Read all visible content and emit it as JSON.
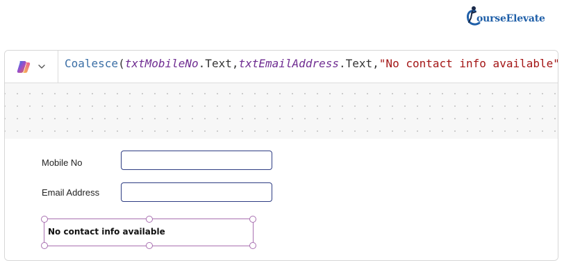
{
  "brand": {
    "logo_text": "ourseElevate",
    "logo_letter": "C",
    "color": "#1f5fa8"
  },
  "formula_bar": {
    "copilot_icon": "copilot-icon",
    "dropdown_icon": "chevron-down-icon",
    "formula": {
      "fn": "Coalesce",
      "open": "(",
      "arg1_control": "txtMobileNo",
      "arg1_prop": ".Text",
      "comma1": ",",
      "arg2_control": "txtEmailAddress",
      "arg2_prop": ".Text",
      "comma2": ",",
      "arg3_string": "\"No contact info available\"",
      "close": ")"
    }
  },
  "form": {
    "mobile_label": "Mobile No",
    "mobile_value": "",
    "email_label": "Email Address",
    "email_value": "",
    "result_text": "No contact info available"
  },
  "colors": {
    "input_border": "#2c3b82",
    "selection": "#a86fb0",
    "string": "#a31515",
    "control": "#6f2c91",
    "function": "#3a6ea5"
  }
}
